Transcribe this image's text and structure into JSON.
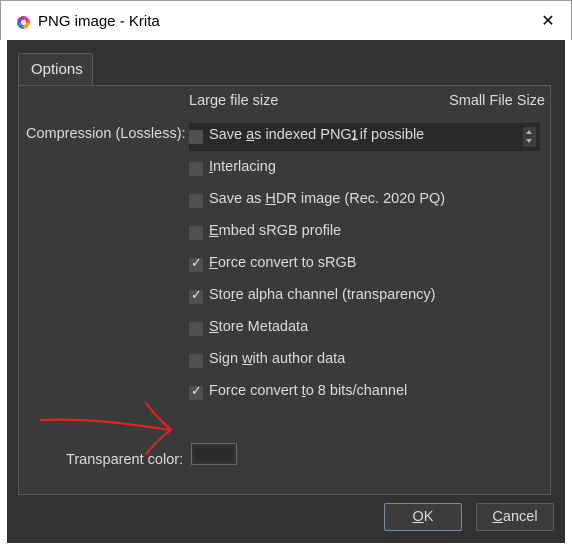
{
  "window": {
    "title": "PNG image - Krita",
    "close_symbol": "✕"
  },
  "tabs": [
    {
      "label": "Options",
      "active": true
    }
  ],
  "compression": {
    "label": "Compression (Lossless):",
    "min_label": "Large file size",
    "max_label": "Small File Size",
    "value": "1"
  },
  "checkboxes": [
    {
      "pre": "Save ",
      "mn": "a",
      "post": "s indexed PNG, if possible",
      "checked": false
    },
    {
      "pre": "",
      "mn": "I",
      "post": "nterlacing",
      "checked": false
    },
    {
      "pre": "Save as ",
      "mn": "H",
      "post": "DR image (Rec. 2020 PQ)",
      "checked": false
    },
    {
      "pre": "",
      "mn": "E",
      "post": "mbed sRGB profile",
      "checked": false
    },
    {
      "pre": "",
      "mn": "F",
      "post": "orce convert to sRGB",
      "checked": true
    },
    {
      "pre": "Sto",
      "mn": "r",
      "post": "e alpha channel (transparency)",
      "checked": true
    },
    {
      "pre": "",
      "mn": "S",
      "post": "tore Metadata",
      "checked": false
    },
    {
      "pre": "Sign ",
      "mn": "w",
      "post": "ith author data",
      "checked": false
    },
    {
      "pre": "Force convert ",
      "mn": "t",
      "post": "o 8 bits/channel",
      "checked": true
    }
  ],
  "check_symbol": "✓",
  "transparent_color": {
    "label": "Transparent color:",
    "value_color": "#2b2b2b"
  },
  "buttons": {
    "ok": {
      "mn": "O",
      "rest": "K"
    },
    "cancel": {
      "mn": "C",
      "rest": "ancel"
    }
  },
  "annotation": {
    "color": "#e0241b"
  }
}
